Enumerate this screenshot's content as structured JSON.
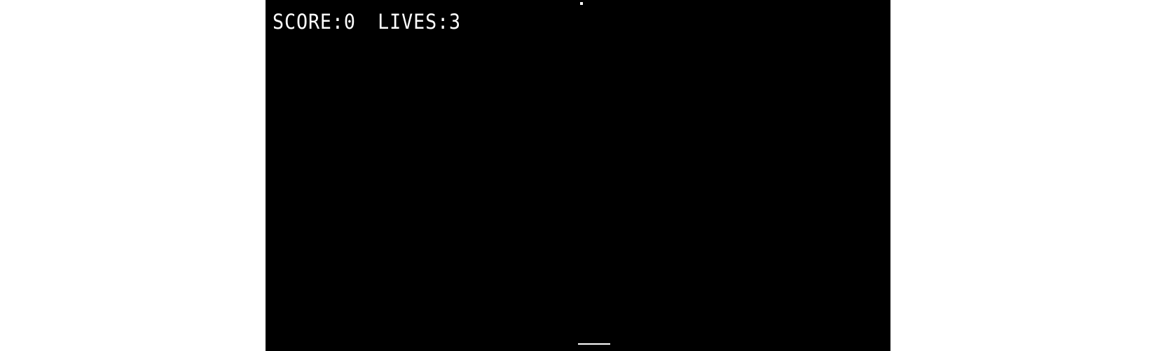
{
  "hud": {
    "score_text": "SCORE:0",
    "lives_text": "LIVES:3"
  },
  "colors": {
    "background": "#000000",
    "foreground": "#ffffff",
    "page": "#ffffff"
  }
}
